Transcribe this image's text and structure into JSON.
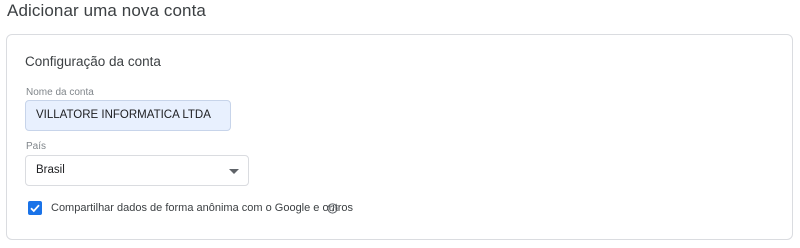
{
  "header": {
    "title": "Adicionar uma nova conta"
  },
  "account_config": {
    "section_title": "Configuração da conta",
    "account_name": {
      "label": "Nome da conta",
      "value": "VILLATORE INFORMATICA LTDA"
    },
    "country": {
      "label": "País",
      "selected": "Brasil"
    },
    "share_data": {
      "checked": true,
      "label": "Compartilhar dados de forma anônima com o Google e outros"
    }
  },
  "colors": {
    "accent": "#1a73e8",
    "input_fill": "#e8f0fe",
    "border": "#dadce0"
  },
  "icons": {
    "dropdown": "chevron-down-icon",
    "checkbox": "checkmark-icon",
    "help": "help-circle-icon"
  }
}
